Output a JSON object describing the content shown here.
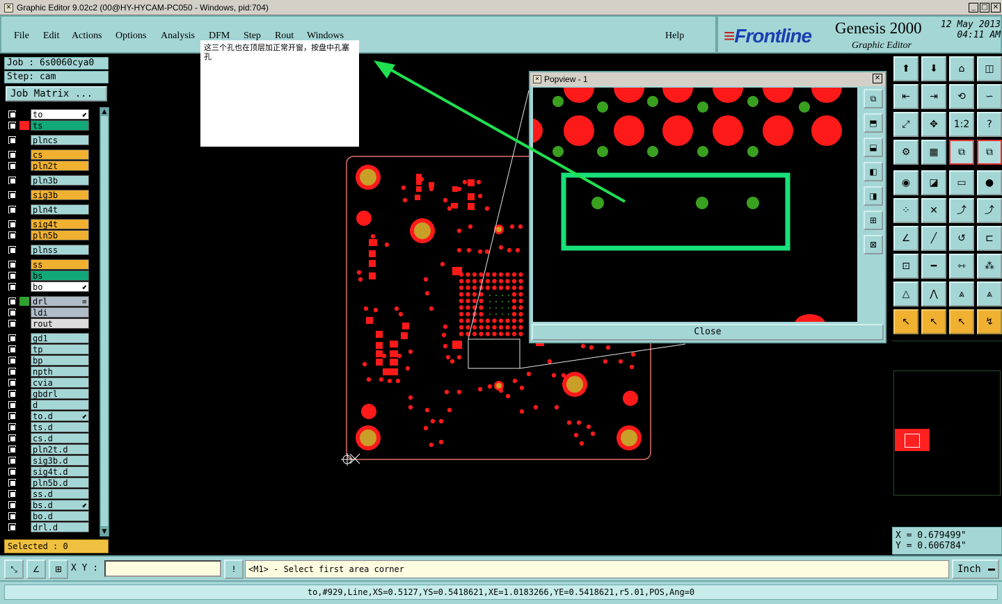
{
  "window": {
    "title": "Graphic Editor 9.02c2 (00@HY-HYCAM-PC050 - Windows, pid:704)"
  },
  "menu": {
    "items": [
      "File",
      "Edit",
      "Actions",
      "Options",
      "Analysis",
      "DFM",
      "Step",
      "Rout",
      "Windows"
    ],
    "help": "Help"
  },
  "logo": {
    "brand": "Frontline",
    "product": "Genesis 2000",
    "subtitle": "Graphic Editor",
    "date": "12 May 2013",
    "time": "04:11 AM"
  },
  "job": {
    "job_label": "Job : 6s0060cya0",
    "step_label": "Step: cam",
    "matrix_button": "Job Matrix ..."
  },
  "layers": [
    {
      "name": "to",
      "bg": "#ffffff",
      "swatch": "#000000",
      "affected": true
    },
    {
      "name": "ts",
      "bg": "#11a87a",
      "swatch": "#ff2020"
    },
    {
      "name": "plncs",
      "bg": "#a5d6d6"
    },
    {
      "name": "cs",
      "bg": "#f0b030"
    },
    {
      "name": "pln2t",
      "bg": "#f0b030"
    },
    {
      "name": "pln3b",
      "bg": "#a5d6d6"
    },
    {
      "name": "sig3b",
      "bg": "#f0b030"
    },
    {
      "name": "pln4t",
      "bg": "#a5d6d6"
    },
    {
      "name": "sig4t",
      "bg": "#f0b030"
    },
    {
      "name": "pln5b",
      "bg": "#f0b030"
    },
    {
      "name": "plnss",
      "bg": "#a5d6d6"
    },
    {
      "name": "ss",
      "bg": "#f0b030"
    },
    {
      "name": "bs",
      "bg": "#11a87a"
    },
    {
      "name": "bo",
      "bg": "#ffffff",
      "affected": true
    },
    {
      "name": "drl",
      "bg": "#b0bcc8",
      "swatch": "#30a030",
      "mark": "≡"
    },
    {
      "name": "ldi",
      "bg": "#b0bcc8"
    },
    {
      "name": "rout",
      "bg": "#dcdcdc"
    },
    {
      "name": "gd1",
      "bg": "#a5d6d6"
    },
    {
      "name": "tp",
      "bg": "#a5d6d6"
    },
    {
      "name": "bp",
      "bg": "#a5d6d6"
    },
    {
      "name": "npth",
      "bg": "#a5d6d6"
    },
    {
      "name": "cvia",
      "bg": "#a5d6d6"
    },
    {
      "name": "gbdrl",
      "bg": "#a5d6d6"
    },
    {
      "name": "d",
      "bg": "#a5d6d6"
    },
    {
      "name": "to.d",
      "bg": "#a5d6d6",
      "affected": true
    },
    {
      "name": "ts.d",
      "bg": "#a5d6d6"
    },
    {
      "name": "cs.d",
      "bg": "#a5d6d6"
    },
    {
      "name": "pln2t.d",
      "bg": "#a5d6d6"
    },
    {
      "name": "sig3b.d",
      "bg": "#a5d6d6"
    },
    {
      "name": "sig4t.d",
      "bg": "#a5d6d6"
    },
    {
      "name": "pln5b.d",
      "bg": "#a5d6d6"
    },
    {
      "name": "ss.d",
      "bg": "#a5d6d6"
    },
    {
      "name": "bs.d",
      "bg": "#a5d6d6",
      "affected": true
    },
    {
      "name": "bo.d",
      "bg": "#a5d6d6"
    },
    {
      "name": "drl.d",
      "bg": "#a5d6d6"
    }
  ],
  "selected": "Selected : 0",
  "note": {
    "text": "这三个孔也在顶层加正常开窗，按盘中孔塞孔"
  },
  "popview": {
    "title": "Popview - 1",
    "close_button": "Close"
  },
  "coords": {
    "x": "X = 0.679499\"",
    "y": "Y = 0.606784\""
  },
  "command": {
    "xy_label": "X Y :",
    "xy_value": "",
    "prompt": "<M1> - Select first area corner",
    "units": "Inch"
  },
  "status": "to,#929,Line,XS=0.5127,YS=0.5418621,XE=1.0183266,YE=0.5418621,r5.01,POS,Ang=0",
  "colors": {
    "panel": "#a5d6d6",
    "pad_red": "#ff1a1a",
    "pad_gold": "#c8a028",
    "drill_green": "#3aa020",
    "highlight_green": "#18e07a",
    "arrow_green": "#20e050"
  }
}
